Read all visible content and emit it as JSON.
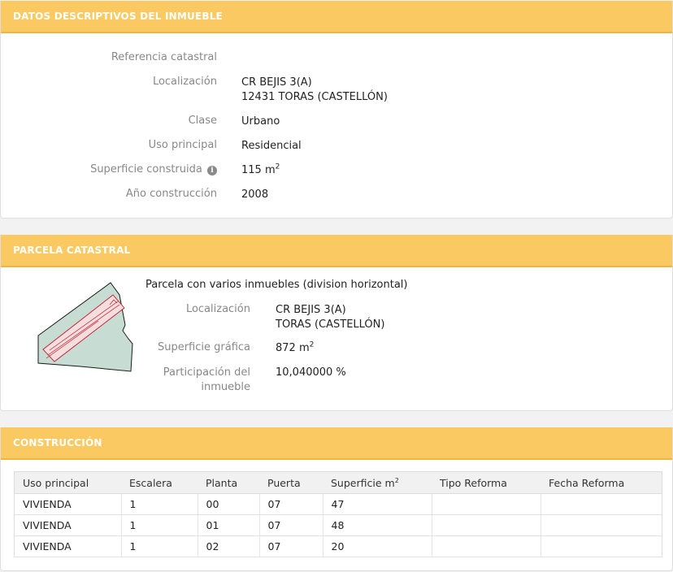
{
  "descriptivos": {
    "header": "DATOS DESCRIPTIVOS DEL INMUEBLE",
    "referencia_label": "Referencia catastral",
    "referencia_value": "",
    "localizacion_label": "Localización",
    "localizacion_line1": "CR BEJIS 3(A)",
    "localizacion_line2": "12431 TORAS (CASTELLÓN)",
    "clase_label": "Clase",
    "clase_value": "Urbano",
    "uso_label": "Uso principal",
    "uso_value": "Residencial",
    "superficie_label": "Superficie construida",
    "superficie_value": "115 m",
    "superficie_unit_sup": "2",
    "anio_label": "Año construcción",
    "anio_value": "2008"
  },
  "parcela": {
    "header": "PARCELA CATASTRAL",
    "descripcion": "Parcela con varios inmuebles (division horizontal)",
    "localizacion_label": "Localización",
    "localizacion_line1": "CR BEJIS 3(A)",
    "localizacion_line2": "TORAS (CASTELLÓN)",
    "superficie_label": "Superficie gráfica",
    "superficie_value": "872 m",
    "superficie_unit_sup": "2",
    "participacion_label_line1": "Participación del",
    "participacion_label_line2": "inmueble",
    "participacion_value": "10,040000 %",
    "map_colors": {
      "parcel_fill": "#c7ddd4",
      "building_fill": "#f6dede",
      "building_stroke": "#c0192b"
    }
  },
  "construccion": {
    "header": "CONSTRUCCIÓN",
    "columns": [
      "Uso principal",
      "Escalera",
      "Planta",
      "Puerta",
      "Superficie m",
      "Tipo Reforma",
      "Fecha Reforma"
    ],
    "superficie_unit_sup": "2",
    "rows": [
      [
        "VIVIENDA",
        "1",
        "00",
        "07",
        "47",
        "",
        ""
      ],
      [
        "VIVIENDA",
        "1",
        "01",
        "07",
        "48",
        "",
        ""
      ],
      [
        "VIVIENDA",
        "1",
        "02",
        "07",
        "20",
        "",
        ""
      ]
    ]
  },
  "colors": {
    "header_bg": "#fbc962",
    "header_text": "#ffffff",
    "label_text": "#888888"
  }
}
